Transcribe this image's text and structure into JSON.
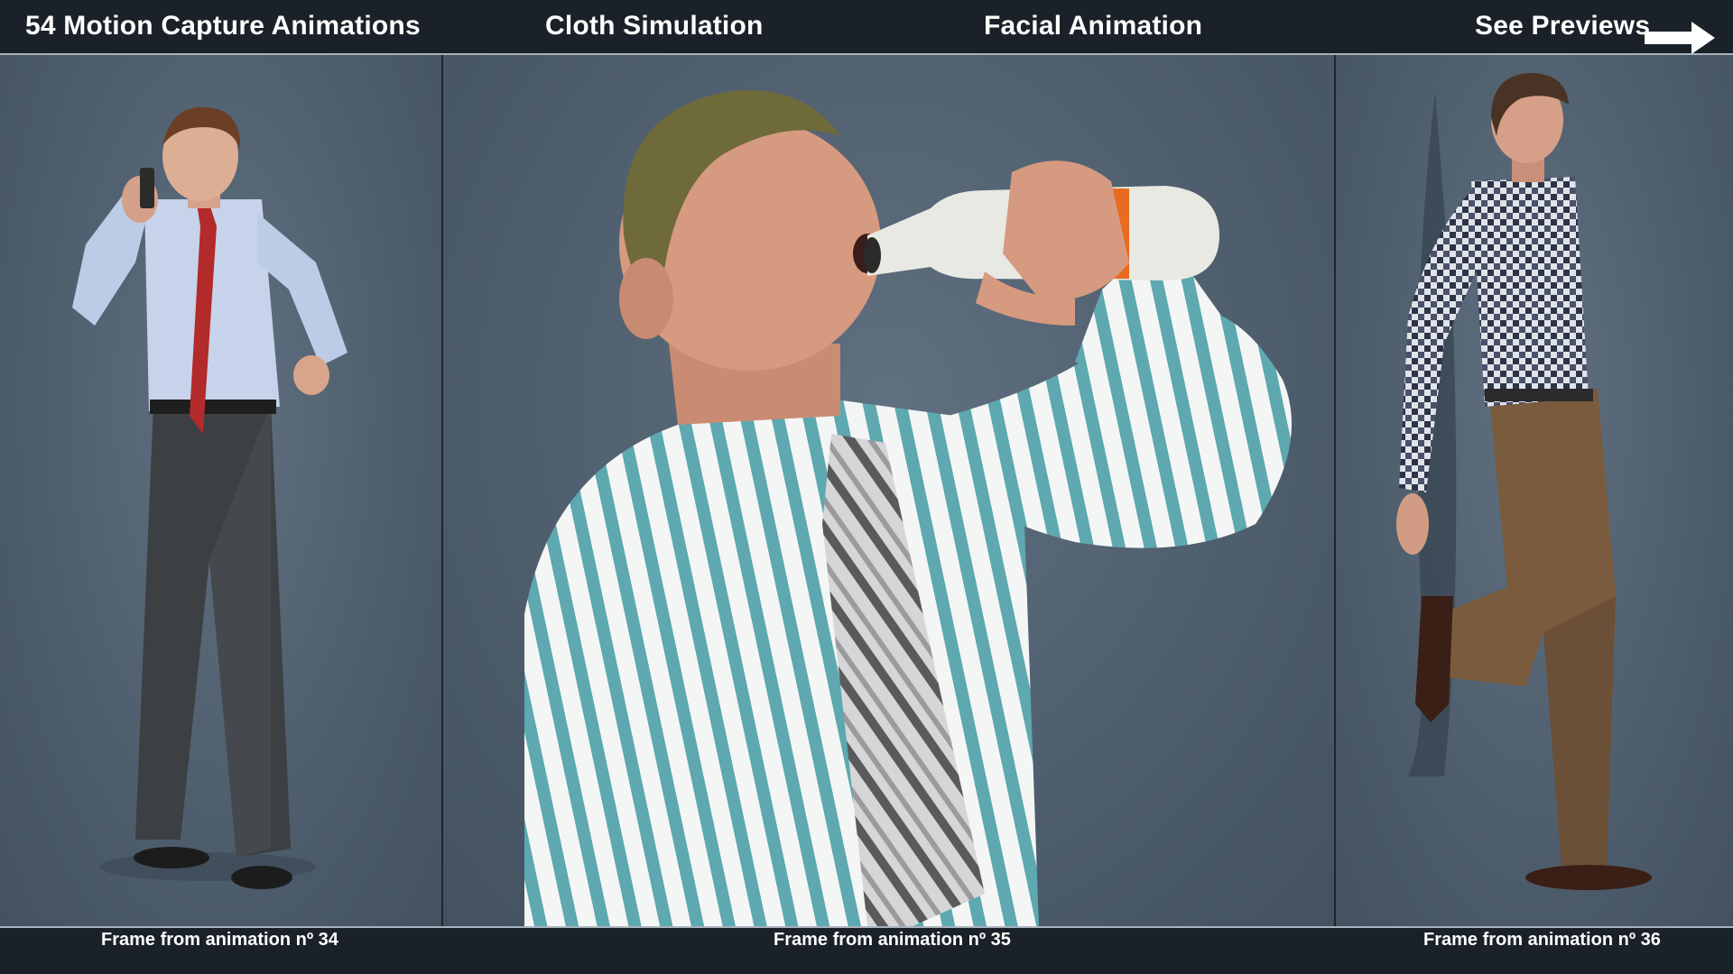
{
  "header": {
    "item1": "54 Motion Capture Animations",
    "item2": "Cloth Simulation",
    "item3": "Facial Animation",
    "item4": "See Previews"
  },
  "captions": [
    "Frame from animation nº 34",
    "Frame from animation nº 35",
    "Frame from animation nº 36"
  ],
  "icons": {
    "arrow": "arrow-right-icon"
  },
  "colors": {
    "bar": "#1b2128",
    "panel_bg": "#4b5a69",
    "text": "#ffffff"
  }
}
